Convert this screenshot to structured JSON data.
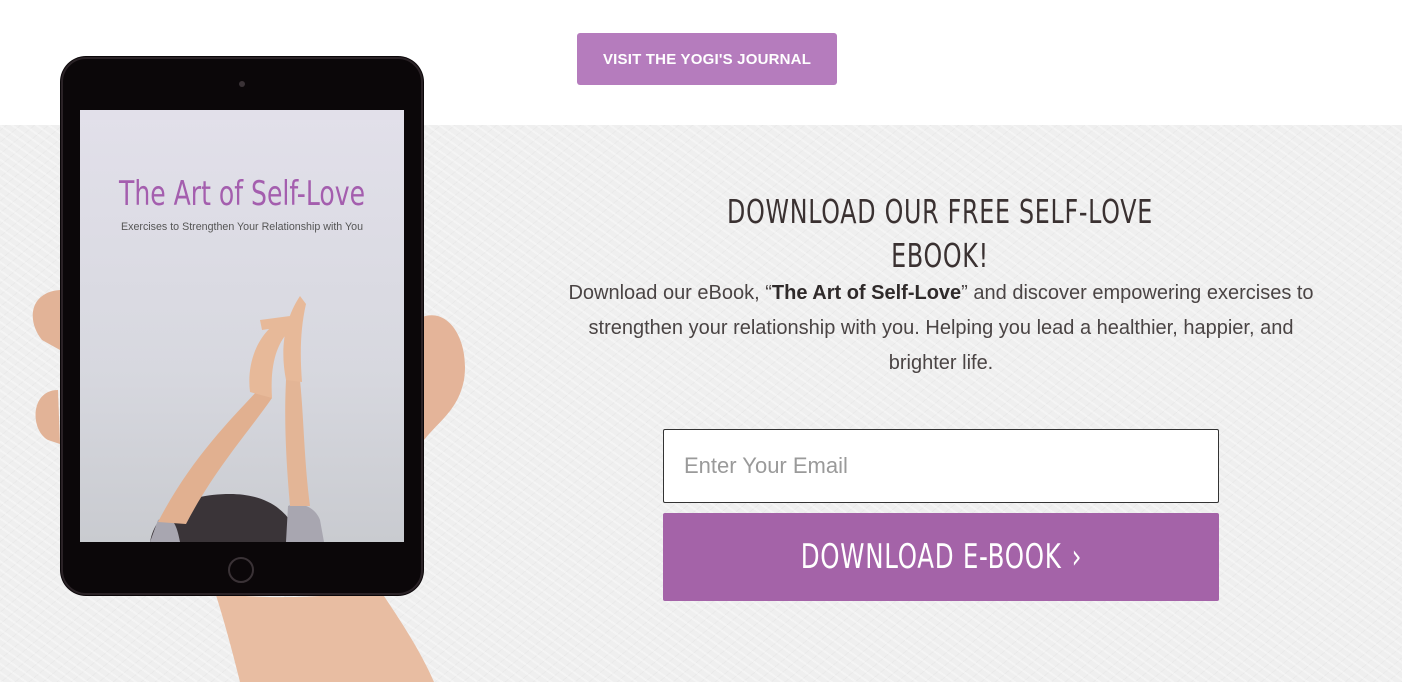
{
  "top": {
    "journal_button": "VISIT THE YOGI'S JOURNAL"
  },
  "ebook": {
    "cover_title": "The Art of Self-Love",
    "cover_subtitle": "Exercises to Strengthen Your Relationship with You"
  },
  "signup": {
    "headline": "DOWNLOAD OUR FREE SELF-LOVE EBOOK!",
    "desc_before": "Download our eBook, “",
    "desc_bold": "The Art of Self-Love",
    "desc_after": "” and discover empowering exercises to strengthen your relationship with you. Helping you lead a healthier, happier, and brighter life.",
    "email_placeholder": "Enter Your Email",
    "download_label": "DOWNLOAD E-BOOK",
    "download_icon": "chevron-right-icon"
  },
  "colors": {
    "accent": "#b57cbd",
    "button": "#a463a8",
    "heading": "#3a3131",
    "section_bg": "#efefef"
  }
}
